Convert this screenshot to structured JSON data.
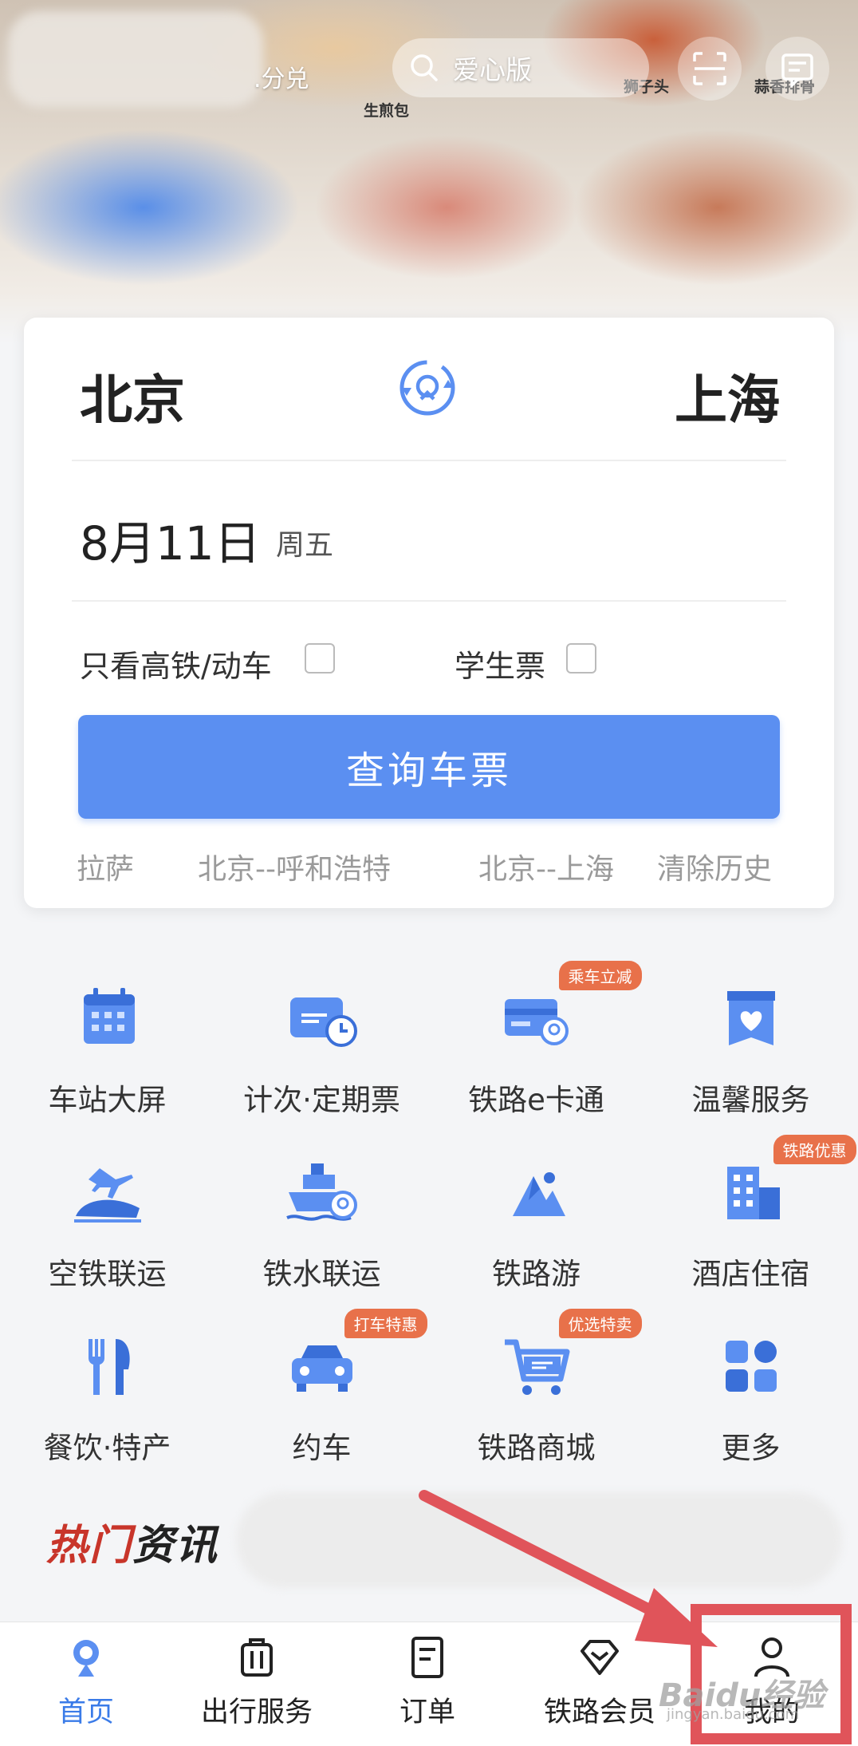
{
  "header": {
    "redeem_text": ".分兑",
    "search_label": "爱心版",
    "food_labels": [
      "生煎包",
      "狮子头",
      "蒜香排骨"
    ]
  },
  "ticket": {
    "from_city": "北京",
    "to_city": "上海",
    "date": "8月11日",
    "weekday": "周五",
    "option_highspeed": "只看高铁/动车",
    "option_student": "学生票",
    "search_button": "查询车票",
    "history": [
      "拉萨",
      "北京--呼和浩特",
      "北京--上海"
    ],
    "clear_history": "清除历史"
  },
  "services": [
    {
      "label": "车站大屏",
      "icon": "calendar-icon"
    },
    {
      "label": "计次·定期票",
      "icon": "card-clock-icon"
    },
    {
      "label": "铁路e卡通",
      "icon": "ecard-icon",
      "tag": "乘车立减"
    },
    {
      "label": "温馨服务",
      "icon": "heart-service-icon"
    },
    {
      "label": "空铁联运",
      "icon": "plane-train-icon"
    },
    {
      "label": "铁水联运",
      "icon": "ship-train-icon"
    },
    {
      "label": "铁路游",
      "icon": "mountain-icon"
    },
    {
      "label": "酒店住宿",
      "icon": "hotel-icon",
      "tag": "铁路优惠"
    },
    {
      "label": "餐饮·特产",
      "icon": "fork-knife-icon"
    },
    {
      "label": "约车",
      "icon": "car-icon",
      "tag": "打车特惠"
    },
    {
      "label": "铁路商城",
      "icon": "cart-icon",
      "tag": "优选特卖"
    },
    {
      "label": "更多",
      "icon": "grid-more-icon"
    }
  ],
  "hot_news": {
    "title_part1": "热门",
    "title_part2": "资讯"
  },
  "tabbar": [
    {
      "label": "首页",
      "icon": "railway-logo-icon",
      "active": true
    },
    {
      "label": "出行服务",
      "icon": "suitcase-icon",
      "active": false
    },
    {
      "label": "订单",
      "icon": "document-icon",
      "active": false
    },
    {
      "label": "铁路会员",
      "icon": "diamond-icon",
      "active": false
    },
    {
      "label": "我的",
      "icon": "person-icon",
      "active": false
    }
  ],
  "watermark": {
    "brand": "Baidu经验",
    "url": "jingyan.baidu.com"
  },
  "colors": {
    "accent": "#5b8ff1",
    "tab_active": "#3a7be8",
    "tag": "#e8714a",
    "highlight": "#e0545a"
  }
}
